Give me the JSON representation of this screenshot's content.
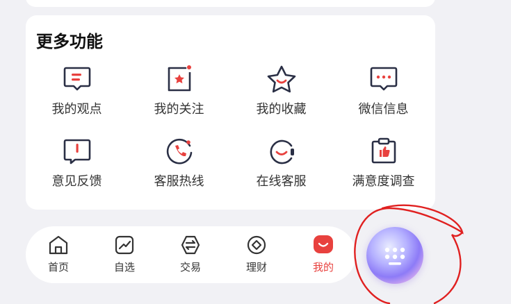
{
  "section": {
    "title": "更多功能"
  },
  "functions": [
    {
      "label": "我的观点",
      "icon": "opinion-icon"
    },
    {
      "label": "我的关注",
      "icon": "follow-icon"
    },
    {
      "label": "我的收藏",
      "icon": "favorite-star-icon"
    },
    {
      "label": "微信信息",
      "icon": "wechat-message-icon"
    },
    {
      "label": "意见反馈",
      "icon": "feedback-icon"
    },
    {
      "label": "客服热线",
      "icon": "hotline-phone-icon"
    },
    {
      "label": "在线客服",
      "icon": "online-service-headset-icon"
    },
    {
      "label": "满意度调查",
      "icon": "survey-thumbs-up-icon"
    }
  ],
  "bottom_nav": [
    {
      "label": "首页",
      "icon": "home-icon",
      "active": false
    },
    {
      "label": "自选",
      "icon": "watchlist-chart-icon",
      "active": false
    },
    {
      "label": "交易",
      "icon": "trade-exchange-icon",
      "active": false
    },
    {
      "label": "理财",
      "icon": "wealth-icon",
      "active": false
    },
    {
      "label": "我的",
      "icon": "profile-smile-icon",
      "active": true
    }
  ],
  "fab": {
    "icon": "keypad-icon"
  },
  "colors": {
    "accent": "#e8413e",
    "icon_dark": "#2a2f45",
    "annotation": "#e02020"
  }
}
